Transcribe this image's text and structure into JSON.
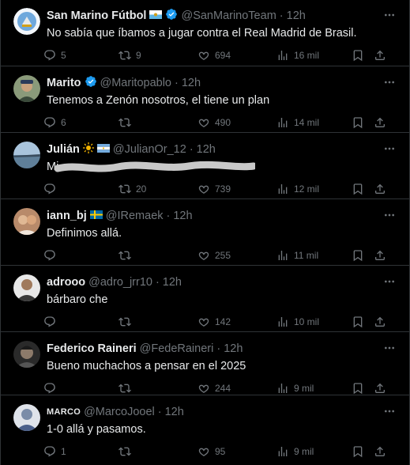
{
  "tweets": [
    {
      "name": "San Marino Fútbol",
      "handle": "@SanMarinoTeam",
      "time": "12h",
      "text": "No sabía que íbamos a jugar contra el Real Madrid de Brasil.",
      "replies": "5",
      "retweets": "9",
      "likes": "694",
      "views": "16 mil"
    },
    {
      "name": "Marito",
      "handle": "@Maritopablo",
      "time": "12h",
      "text": "Tenemos a Zenón nosotros, el tiene un plan",
      "replies": "6",
      "retweets": "",
      "likes": "490",
      "views": "14 mil"
    },
    {
      "name": "Julián",
      "handle": "@JulianOr_12",
      "time": "12h",
      "text": "Mi...",
      "replies": "",
      "retweets": "20",
      "likes": "739",
      "views": "12 mil"
    },
    {
      "name": "iann_bj",
      "handle": "@IRemaek",
      "time": "12h",
      "text": "Definimos allá.",
      "replies": "",
      "retweets": "",
      "likes": "255",
      "views": "11 mil"
    },
    {
      "name": "adrooo",
      "handle": "@adro_jrr10",
      "time": "12h",
      "text": "bárbaro che",
      "replies": "",
      "retweets": "",
      "likes": "142",
      "views": "10 mil"
    },
    {
      "name": "Federico Raineri",
      "handle": "@FedeRaineri",
      "time": "12h",
      "text": "Bueno muchachos a pensar en el 2025",
      "replies": "",
      "retweets": "",
      "likes": "244",
      "views": "9 mil"
    },
    {
      "name": "MARCO",
      "handle": "@MarcoJooel",
      "time": "12h",
      "text": "1-0 allá y pasamos.",
      "replies": "1",
      "retweets": "",
      "likes": "95",
      "views": "9 mil"
    }
  ],
  "colors": {
    "background": "#000000",
    "text": "#e7e9ea",
    "muted": "#71767b",
    "border": "#2f3336",
    "verified": "#1d9bf0"
  },
  "icons": [
    "more-icon",
    "reply-icon",
    "retweet-icon",
    "like-icon",
    "views-icon",
    "bookmark-icon",
    "share-icon",
    "verified-icon",
    "flag-icon",
    "sun-icon"
  ]
}
